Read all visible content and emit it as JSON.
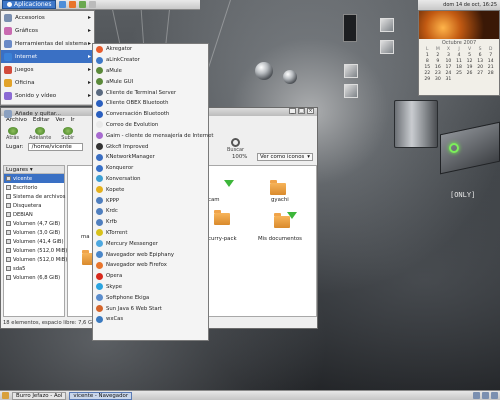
{
  "top_panel": {
    "apps_label": "Aplicaciones",
    "clock": "dom 14 de oct, 16:25"
  },
  "calendar": {
    "month": "Octubre",
    "year": "2007",
    "day_headers": [
      "L",
      "M",
      "X",
      "J",
      "V",
      "S",
      "D"
    ],
    "days": [
      "1",
      "2",
      "3",
      "4",
      "5",
      "6",
      "7",
      "8",
      "9",
      "10",
      "11",
      "12",
      "13",
      "14",
      "15",
      "16",
      "17",
      "18",
      "19",
      "20",
      "21",
      "22",
      "23",
      "24",
      "25",
      "26",
      "27",
      "28",
      "29",
      "30",
      "31"
    ]
  },
  "apps_menu": {
    "items": [
      {
        "label": "Accesorios",
        "icon": "accessories-icon",
        "color": "#7a8fb0"
      },
      {
        "label": "Gráficos",
        "icon": "graphics-icon",
        "color": "#c96ab0"
      },
      {
        "label": "Herramientas del sistema",
        "icon": "system-tools-icon",
        "color": "#6a8ac7"
      },
      {
        "label": "Internet",
        "icon": "internet-icon",
        "color": "#3b82d8"
      },
      {
        "label": "Juegos",
        "icon": "games-icon",
        "color": "#d24b3b"
      },
      {
        "label": "Oficina",
        "icon": "office-icon",
        "color": "#e2a32a"
      },
      {
        "label": "Sonido y vídeo",
        "icon": "sound-video-icon",
        "color": "#8b6ad4"
      }
    ],
    "add_remove": "Añade y quitar..."
  },
  "internet_menu": {
    "items": [
      {
        "label": "Akregator",
        "icon": "akregator-icon",
        "color": "#e85b2c"
      },
      {
        "label": "aLinkCreator",
        "icon": "alinkcreator-icon",
        "color": "#3e79c9"
      },
      {
        "label": "aMule",
        "icon": "amule-icon",
        "color": "#5b8a3a"
      },
      {
        "label": "aMule GUI",
        "icon": "amule-gui-icon",
        "color": "#5b8a3a"
      },
      {
        "label": "Cliente de Terminal Server",
        "icon": "terminal-server-icon",
        "color": "#5a6a80"
      },
      {
        "label": "Cliente OBEX Bluetooth",
        "icon": "bluetooth-icon",
        "color": "#2a5fbf"
      },
      {
        "label": "Conversación Bluetooth",
        "icon": "bluetooth-chat-icon",
        "color": "#2a5fbf"
      },
      {
        "label": "Correo de Evolution",
        "icon": "evolution-icon",
        "color": "#e9e9e9"
      },
      {
        "label": "Gaim - cliente de mensajería de Internet",
        "icon": "gaim-icon",
        "color": "#a86bd0"
      },
      {
        "label": "Gtkcfi Improved",
        "icon": "gtkcfi-icon",
        "color": "#333333"
      },
      {
        "label": "KNetworkManager",
        "icon": "knetworkmanager-icon",
        "color": "#3a6ec2"
      },
      {
        "label": "Konqueror",
        "icon": "konqueror-icon",
        "color": "#3670c9"
      },
      {
        "label": "Konversation",
        "icon": "konversation-icon",
        "color": "#3c9fd3"
      },
      {
        "label": "Kopete",
        "icon": "kopete-icon",
        "color": "#e5b11c"
      },
      {
        "label": "KPPP",
        "icon": "kppp-icon",
        "color": "#4f7fbf"
      },
      {
        "label": "Krdc",
        "icon": "krdc-icon",
        "color": "#4f7fbf"
      },
      {
        "label": "Krfb",
        "icon": "krfb-icon",
        "color": "#4f7fbf"
      },
      {
        "label": "KTorrent",
        "icon": "ktorrent-icon",
        "color": "#d8c11a"
      },
      {
        "label": "Mercury Messenger",
        "icon": "mercury-icon",
        "color": "#4da8e0"
      },
      {
        "label": "Navegador web Epiphany",
        "icon": "epiphany-icon",
        "color": "#4a86c8"
      },
      {
        "label": "Navegador web Firefox",
        "icon": "firefox-icon",
        "color": "#e8742b"
      },
      {
        "label": "Opera",
        "icon": "opera-icon",
        "color": "#d8291c"
      },
      {
        "label": "Skype",
        "icon": "skype-icon",
        "color": "#2aa4e0"
      },
      {
        "label": "Softphone Ekiga",
        "icon": "ekiga-icon",
        "color": "#5a8ccc"
      },
      {
        "label": "Sun Java 6 Web Start",
        "icon": "java-icon",
        "color": "#d5642a"
      },
      {
        "label": "wxCas",
        "icon": "wxcas-icon",
        "color": "#3a7ac0"
      }
    ]
  },
  "file_manager": {
    "menus": [
      "Archivo",
      "Editar",
      "Ver",
      "Ir"
    ],
    "toolbar": {
      "back": "Atrás",
      "forward": "Adelante",
      "up": "Subir",
      "search": "Buscar"
    },
    "location_label": "Lugar:",
    "location_value": "/home/vicente",
    "zoom": "100%",
    "view_mode": "Ver como iconos",
    "sidebar_title": "Lugares",
    "places": [
      "vicente",
      "Escritorio",
      "Sistema de archivos",
      "Disquetera",
      "DEBIAN",
      "Volumen (4,7 GiB)",
      "Volumen (3,0 GiB)",
      "Volumen (41,4 GiB)",
      "Volumen (512,0 MiB)",
      "Volumen (512,0 MiB)",
      "sda5",
      "Volumen (6,8 GiB)"
    ],
    "files": [
      {
        "label": "cam"
      },
      {
        "label": "gyachi"
      },
      {
        "label": "ma"
      },
      {
        "label": "curry-pack"
      },
      {
        "label": "Mis documentos"
      }
    ],
    "status": "18 elementos, espacio libre: 7,6 GiB"
  },
  "desktop": {
    "only_label": "[ONLY]"
  },
  "bottom_panel": {
    "tasks": [
      "Burro Jefazo - Aol",
      "vicente - Navegador"
    ]
  }
}
